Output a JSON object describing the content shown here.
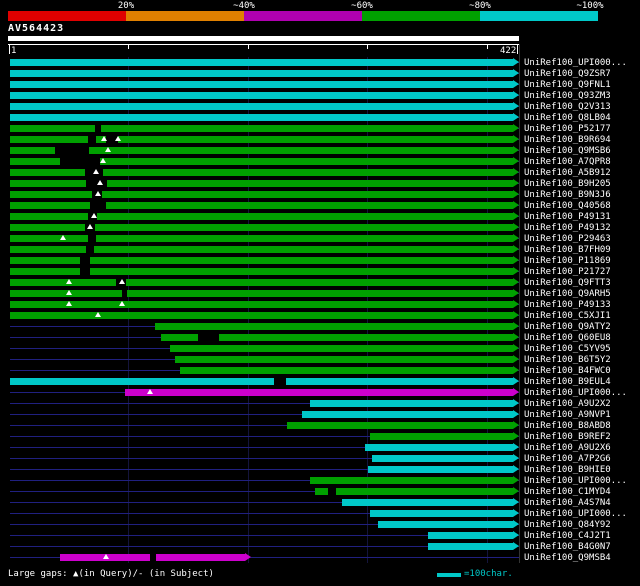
{
  "colors": {
    "cyan": "#00c8c8",
    "green": "#00a000",
    "magenta": "#cc00cc",
    "line": "#202080",
    "white": "#ffffff"
  },
  "chart_data": {
    "type": "bar",
    "title": "AV564423",
    "query_name": "AV564423",
    "xlim": [
      1,
      422
    ],
    "axis": {
      "start": "1",
      "end": "422"
    },
    "scale_labels": [
      "20%",
      "~40%",
      "~60%",
      "~80%",
      "~100%"
    ],
    "scale_colors": [
      "#e00000",
      "#e08000",
      "#b000b0",
      "#00a000",
      "#00c8c8"
    ],
    "legend_gaps": "Large gaps: ▲(in Query)/- (in Subject)",
    "legend_scale": "=100char.",
    "series": [
      {
        "label": "UniRef100_UPI000...",
        "color": "cyan",
        "start": 1,
        "end": 422
      },
      {
        "label": "UniRef100_Q9ZSR7",
        "color": "cyan",
        "start": 1,
        "end": 422
      },
      {
        "label": "UniRef100_Q9FNL1",
        "color": "cyan",
        "start": 1,
        "end": 422
      },
      {
        "label": "UniRef100_Q93ZM3",
        "color": "cyan",
        "start": 1,
        "end": 422
      },
      {
        "label": "UniRef100_Q2V313",
        "color": "cyan",
        "start": 1,
        "end": 422
      },
      {
        "label": "UniRef100_Q8LB04",
        "color": "cyan",
        "start": 1,
        "end": 422
      },
      {
        "label": "UniRef100_P52177",
        "color": "green",
        "start": 1,
        "end": 422,
        "gaps": [
          [
            72,
            5
          ]
        ]
      },
      {
        "label": "UniRef100_B9R694",
        "color": "green",
        "start": 1,
        "end": 422,
        "gaps": [
          [
            66,
            7
          ],
          [
            81,
            10
          ]
        ],
        "tris": [
          80,
          91
        ]
      },
      {
        "label": "UniRef100_Q9MSB6",
        "color": "green",
        "start": 1,
        "end": 422,
        "gaps": [
          [
            39,
            28
          ]
        ],
        "tris": [
          83
        ]
      },
      {
        "label": "UniRef100_A7QPR8",
        "color": "green",
        "start": 1,
        "end": 422,
        "gaps": [
          [
            43,
            33
          ]
        ],
        "tris": [
          79
        ]
      },
      {
        "label": "UniRef100_A5B912",
        "color": "green",
        "start": 1,
        "end": 422,
        "gaps": [
          [
            64,
            15
          ]
        ],
        "tris": [
          73
        ]
      },
      {
        "label": "UniRef100_B9H205",
        "color": "green",
        "start": 1,
        "end": 422,
        "gaps": [
          [
            65,
            17
          ]
        ],
        "tris": [
          76
        ]
      },
      {
        "label": "UniRef100_B9N3J6",
        "color": "green",
        "start": 1,
        "end": 422,
        "gaps": [
          [
            70,
            8
          ]
        ],
        "tris": [
          75
        ]
      },
      {
        "label": "UniRef100_Q40568",
        "color": "green",
        "start": 1,
        "end": 422,
        "gaps": [
          [
            68,
            13
          ]
        ]
      },
      {
        "label": "UniRef100_P49131",
        "color": "green",
        "start": 1,
        "end": 422,
        "gaps": [
          [
            66,
            8
          ]
        ],
        "tris": [
          71
        ]
      },
      {
        "label": "UniRef100_P49132",
        "color": "green",
        "start": 1,
        "end": 422,
        "gaps": [
          [
            64,
            8
          ]
        ],
        "tris": [
          68
        ]
      },
      {
        "label": "UniRef100_P29463",
        "color": "green",
        "start": 1,
        "end": 422,
        "gaps": [
          [
            66,
            7
          ]
        ],
        "tris": [
          45
        ]
      },
      {
        "label": "UniRef100_B7FH09",
        "color": "green",
        "start": 1,
        "end": 422,
        "gaps": [
          [
            65,
            6
          ]
        ]
      },
      {
        "label": "UniRef100_P11869",
        "color": "green",
        "start": 1,
        "end": 422,
        "gaps": [
          [
            60,
            8
          ]
        ]
      },
      {
        "label": "UniRef100_P21727",
        "color": "green",
        "start": 1,
        "end": 422,
        "gaps": [
          [
            60,
            8
          ]
        ]
      },
      {
        "label": "UniRef100_Q9FTT3",
        "color": "green",
        "start": 1,
        "end": 422,
        "gaps": [
          [
            90,
            8
          ]
        ],
        "tris": [
          50,
          95
        ]
      },
      {
        "label": "UniRef100_Q9ARH5",
        "color": "green",
        "start": 1,
        "end": 422,
        "gaps": [
          [
            95,
            4
          ]
        ],
        "tris": [
          50
        ]
      },
      {
        "label": "UniRef100_P49133",
        "color": "green",
        "start": 1,
        "end": 422,
        "tris": [
          50,
          95
        ]
      },
      {
        "label": "UniRef100_C5XJI1",
        "color": "green",
        "start": 1,
        "end": 422,
        "tris": [
          75
        ]
      },
      {
        "label": "UniRef100_Q9ATY2",
        "color": "green",
        "start": 122,
        "end": 422
      },
      {
        "label": "UniRef100_Q60EU8",
        "color": "green",
        "start": 127,
        "end": 422,
        "gaps": [
          [
            158,
            18
          ]
        ]
      },
      {
        "label": "UniRef100_C5YV95",
        "color": "green",
        "start": 135,
        "end": 422
      },
      {
        "label": "UniRef100_B6T5Y2",
        "color": "green",
        "start": 139,
        "end": 422
      },
      {
        "label": "UniRef100_B4FWC0",
        "color": "green",
        "start": 143,
        "end": 422
      },
      {
        "label": "UniRef100_B9EUL4",
        "color": "cyan",
        "start": 1,
        "end": 422,
        "gaps": [
          [
            222,
            10
          ]
        ]
      },
      {
        "label": "UniRef100_UPI000...",
        "color": "magenta",
        "start": 97,
        "end": 422,
        "tris": [
          118
        ]
      },
      {
        "label": "UniRef100_A9U2X2",
        "color": "cyan",
        "start": 252,
        "end": 422
      },
      {
        "label": "UniRef100_A9NVP1",
        "color": "cyan",
        "start": 245,
        "end": 422
      },
      {
        "label": "UniRef100_B8ABD8",
        "color": "green",
        "start": 233,
        "end": 422
      },
      {
        "label": "UniRef100_B9REF2",
        "color": "green",
        "start": 302,
        "end": 422
      },
      {
        "label": "UniRef100_A9U2X6",
        "color": "cyan",
        "start": 298,
        "end": 422
      },
      {
        "label": "UniRef100_A7P2G6",
        "color": "cyan",
        "start": 304,
        "end": 422
      },
      {
        "label": "UniRef100_B9HIE0",
        "color": "cyan",
        "start": 301,
        "end": 422
      },
      {
        "label": "UniRef100_UPI000...",
        "color": "green",
        "start": 252,
        "end": 422
      },
      {
        "label": "UniRef100_C1MYD4",
        "color": "green",
        "start": 256,
        "end": 422,
        "gaps": [
          [
            267,
            7
          ]
        ]
      },
      {
        "label": "UniRef100_A4S7N4",
        "color": "cyan",
        "start": 279,
        "end": 422
      },
      {
        "label": "UniRef100_UPI000...",
        "color": "cyan",
        "start": 302,
        "end": 422
      },
      {
        "label": "UniRef100_Q84Y92",
        "color": "cyan",
        "start": 309,
        "end": 422
      },
      {
        "label": "UniRef100_C4J2T1",
        "color": "cyan",
        "start": 351,
        "end": 422
      },
      {
        "label": "UniRef100_B4G0N7",
        "color": "cyan",
        "start": 351,
        "end": 422
      },
      {
        "label": "UniRef100_Q9MSB4",
        "color": "magenta",
        "start": 43,
        "end": 198,
        "gaps": [
          [
            118,
            5
          ]
        ],
        "tris": [
          81
        ]
      }
    ]
  }
}
